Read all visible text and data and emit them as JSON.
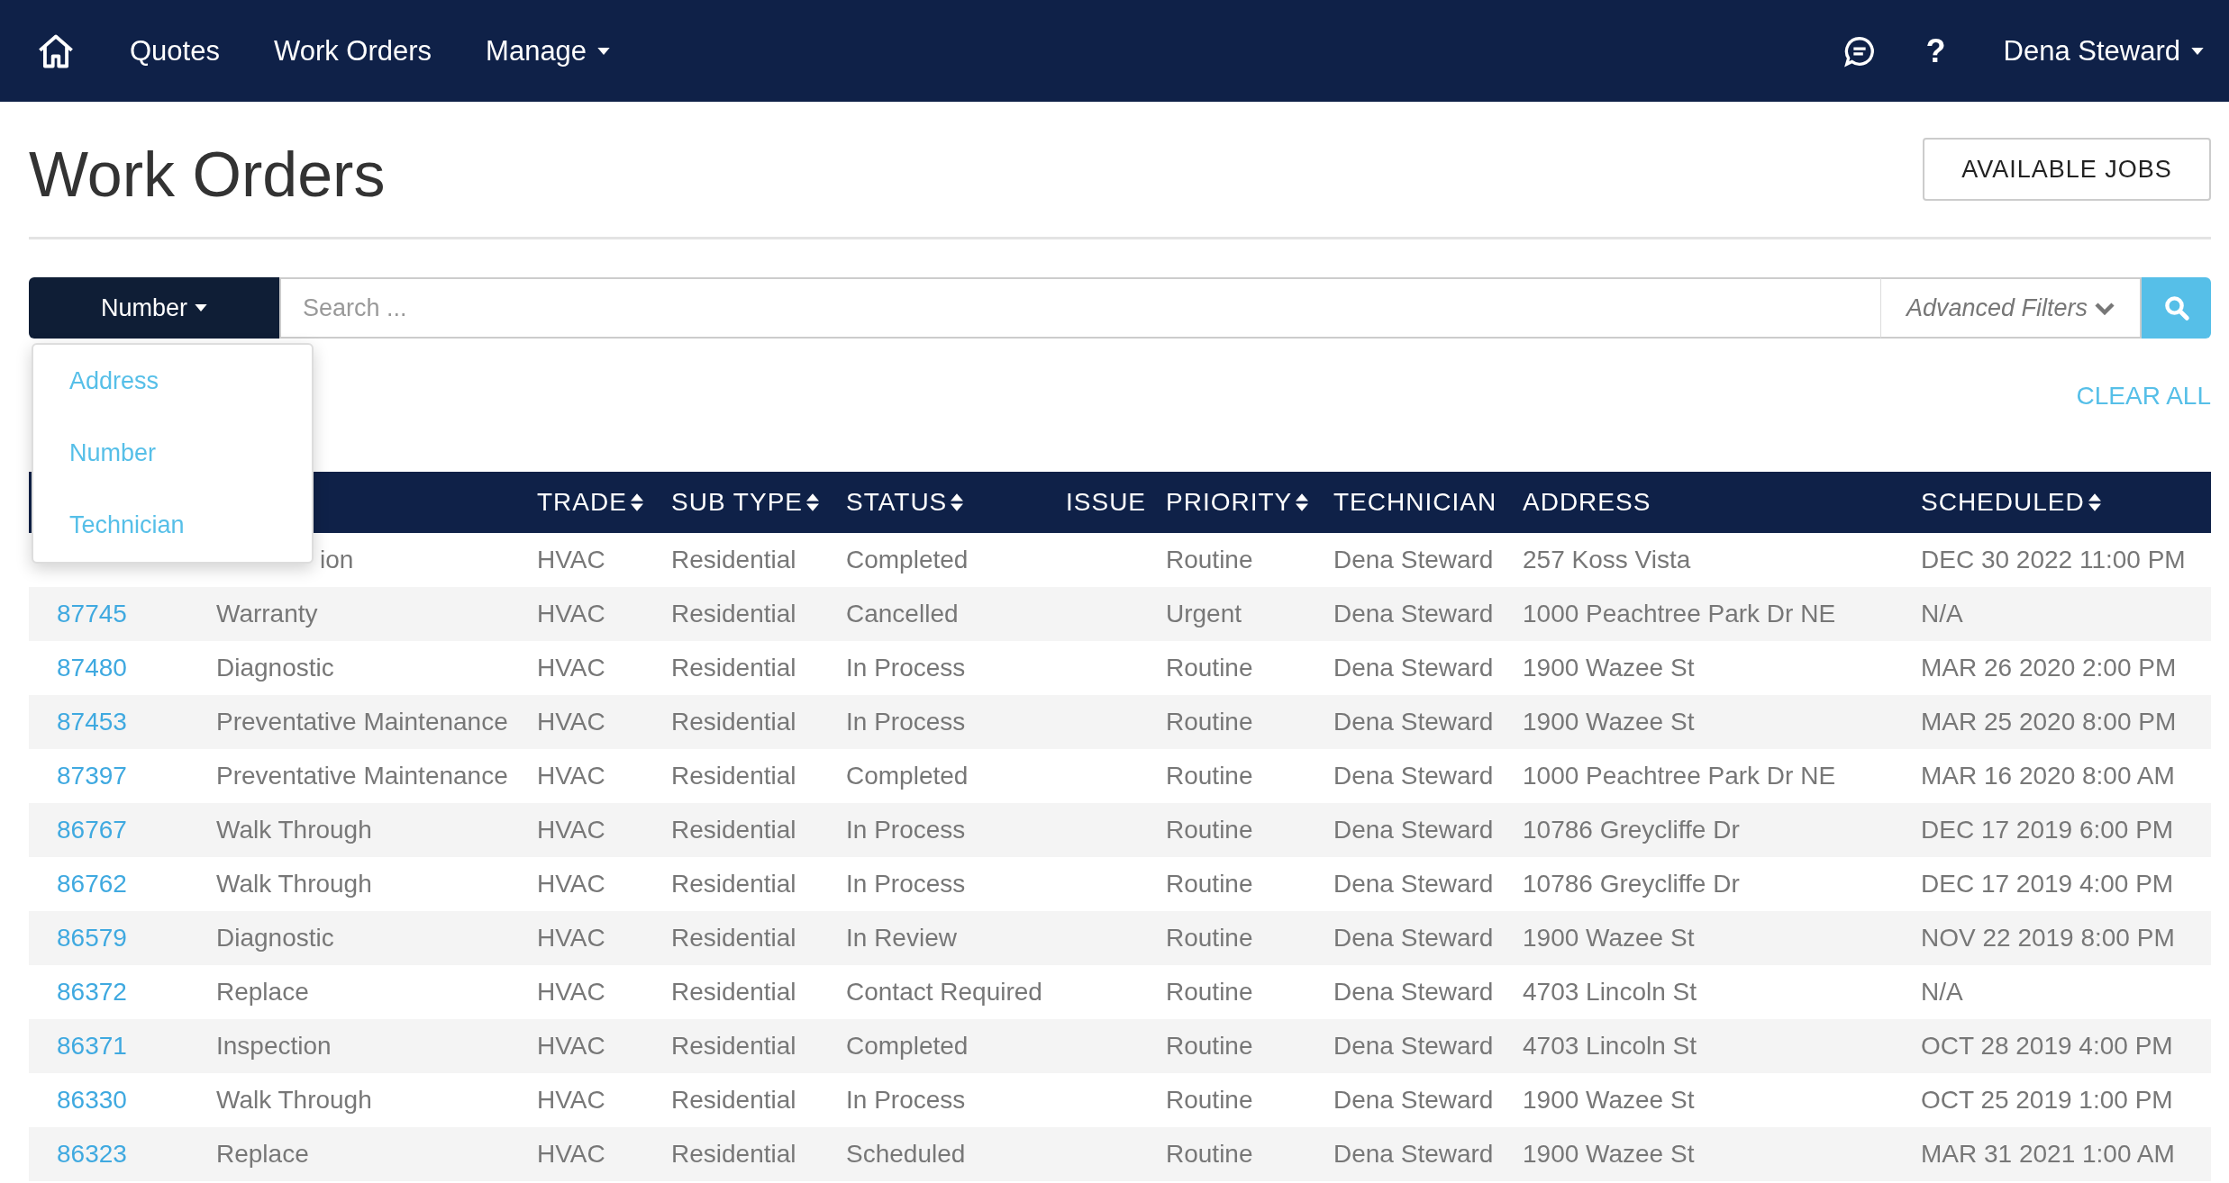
{
  "nav": {
    "links": [
      "Quotes",
      "Work Orders"
    ],
    "manage": "Manage",
    "help": "?",
    "user": "Dena Steward"
  },
  "page": {
    "title": "Work Orders",
    "action": "AVAILABLE JOBS"
  },
  "search": {
    "field_button": "Number",
    "placeholder": "Search ...",
    "advanced": "Advanced Filters",
    "menu": [
      "Address",
      "Number",
      "Technician"
    ]
  },
  "clear_all": "CLEAR ALL",
  "table": {
    "columns": [
      {
        "label": "TRADE",
        "sortable": true
      },
      {
        "label": "SUB TYPE",
        "sortable": true
      },
      {
        "label": "STATUS",
        "sortable": true
      },
      {
        "label": "ISSUE",
        "sortable": false
      },
      {
        "label": "PRIORITY",
        "sortable": true
      },
      {
        "label": "TECHNICIAN",
        "sortable": false
      },
      {
        "label": "ADDRESS",
        "sortable": false
      },
      {
        "label": "SCHEDULED",
        "sortable": true
      }
    ],
    "rows": [
      {
        "covered": true,
        "type": "ion",
        "trade": "HVAC",
        "sub_type": "Residential",
        "status": "Completed",
        "priority": "Routine",
        "technician": "Dena Steward",
        "address": "257 Koss Vista",
        "scheduled": "DEC 30 2022 11:00 PM"
      },
      {
        "covered": false,
        "number": "87745",
        "type": "Warranty",
        "trade": "HVAC",
        "sub_type": "Residential",
        "status": "Cancelled",
        "priority": "Urgent",
        "technician": "Dena Steward",
        "address": "1000 Peachtree Park Dr NE",
        "scheduled": "N/A"
      },
      {
        "covered": false,
        "number": "87480",
        "type": "Diagnostic",
        "trade": "HVAC",
        "sub_type": "Residential",
        "status": "In Process",
        "priority": "Routine",
        "technician": "Dena Steward",
        "address": "1900 Wazee St",
        "scheduled": "MAR 26 2020 2:00 PM"
      },
      {
        "covered": false,
        "number": "87453",
        "type": "Preventative Maintenance",
        "trade": "HVAC",
        "sub_type": "Residential",
        "status": "In Process",
        "priority": "Routine",
        "technician": "Dena Steward",
        "address": "1900 Wazee St",
        "scheduled": "MAR 25 2020 8:00 PM"
      },
      {
        "covered": false,
        "number": "87397",
        "type": "Preventative Maintenance",
        "trade": "HVAC",
        "sub_type": "Residential",
        "status": "Completed",
        "priority": "Routine",
        "technician": "Dena Steward",
        "address": "1000 Peachtree Park Dr NE",
        "scheduled": "MAR 16 2020 8:00 AM"
      },
      {
        "covered": false,
        "number": "86767",
        "type": "Walk Through",
        "trade": "HVAC",
        "sub_type": "Residential",
        "status": "In Process",
        "priority": "Routine",
        "technician": "Dena Steward",
        "address": "10786 Greycliffe Dr",
        "scheduled": "DEC 17 2019 6:00 PM"
      },
      {
        "covered": false,
        "number": "86762",
        "type": "Walk Through",
        "trade": "HVAC",
        "sub_type": "Residential",
        "status": "In Process",
        "priority": "Routine",
        "technician": "Dena Steward",
        "address": "10786 Greycliffe Dr",
        "scheduled": "DEC 17 2019 4:00 PM"
      },
      {
        "covered": false,
        "number": "86579",
        "type": "Diagnostic",
        "trade": "HVAC",
        "sub_type": "Residential",
        "status": "In Review",
        "priority": "Routine",
        "technician": "Dena Steward",
        "address": "1900 Wazee St",
        "scheduled": "NOV 22 2019 8:00 PM"
      },
      {
        "covered": false,
        "number": "86372",
        "type": "Replace",
        "trade": "HVAC",
        "sub_type": "Residential",
        "status": "Contact Required",
        "priority": "Routine",
        "technician": "Dena Steward",
        "address": "4703 Lincoln St",
        "scheduled": "N/A"
      },
      {
        "covered": false,
        "number": "86371",
        "type": "Inspection",
        "trade": "HVAC",
        "sub_type": "Residential",
        "status": "Completed",
        "priority": "Routine",
        "technician": "Dena Steward",
        "address": "4703 Lincoln St",
        "scheduled": "OCT 28 2019 4:00 PM"
      },
      {
        "covered": false,
        "number": "86330",
        "type": "Walk Through",
        "trade": "HVAC",
        "sub_type": "Residential",
        "status": "In Process",
        "priority": "Routine",
        "technician": "Dena Steward",
        "address": "1900 Wazee St",
        "scheduled": "OCT 25 2019 1:00 PM"
      },
      {
        "covered": false,
        "number": "86323",
        "type": "Replace",
        "trade": "HVAC",
        "sub_type": "Residential",
        "status": "Scheduled",
        "priority": "Routine",
        "technician": "Dena Steward",
        "address": "1900 Wazee St",
        "scheduled": "MAR 31 2021 1:00 AM"
      }
    ]
  }
}
